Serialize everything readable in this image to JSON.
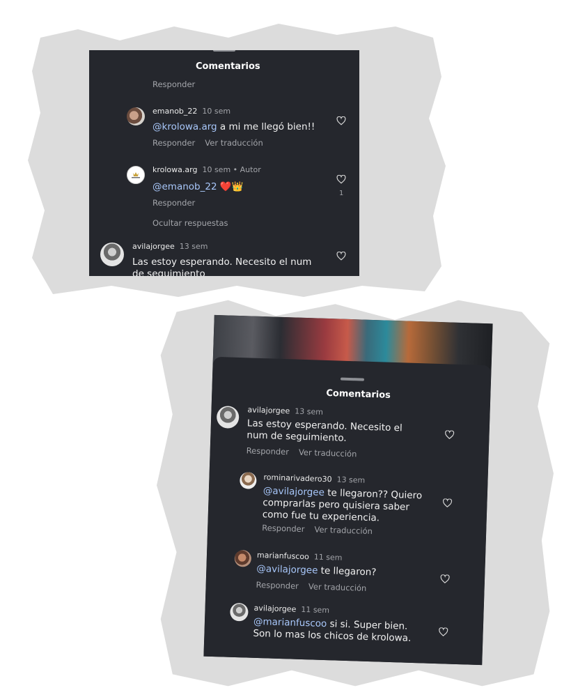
{
  "colors": {
    "panel_bg": "#25272d",
    "mention": "#a8c7fa",
    "muted": "#a3a5aa",
    "brush": "#dcdcdc"
  },
  "screenshot1": {
    "title": "Comentarios",
    "top_reply": "Responder",
    "comments": [
      {
        "user": "emanob_22",
        "time": "10 sem",
        "mention": "@krolowa.arg",
        "text": " a mi me llegó bien!!",
        "reply": "Responder",
        "translate": "Ver traducción"
      },
      {
        "user": "krolowa.arg",
        "time": "10 sem",
        "author_tag": "• Autor",
        "mention": "@emanob_22",
        "text": " ❤️👑",
        "reply": "Responder",
        "likes": "1"
      },
      {
        "user": "avilajorgee",
        "time": "13 sem",
        "text": "Las estoy esperando. Necesito el num de seguimiento"
      }
    ],
    "hide_replies": "Ocultar respuestas"
  },
  "screenshot2": {
    "title": "Comentarios",
    "comments": [
      {
        "user": "avilajorgee",
        "time": "13 sem",
        "text": "Las estoy esperando. Necesito el num de seguimiento.",
        "reply": "Responder",
        "translate": "Ver traducción"
      },
      {
        "user": "rominarivadero30",
        "time": "13 sem",
        "mention": "@avilajorgee",
        "text": " te llegaron?? Quiero comprarlas pero quisiera saber como fue tu experiencia.",
        "reply": "Responder",
        "translate": "Ver traducción"
      },
      {
        "user": "marianfuscoo",
        "time": "11 sem",
        "mention": "@avilajorgee",
        "text": " te llegaron?",
        "reply": "Responder",
        "translate": "Ver traducción"
      },
      {
        "user": "avilajorgee",
        "time": "11 sem",
        "mention": "@marianfuscoo",
        "text": " si si. Super bien. Son lo mas los chicos de krolowa."
      }
    ]
  }
}
